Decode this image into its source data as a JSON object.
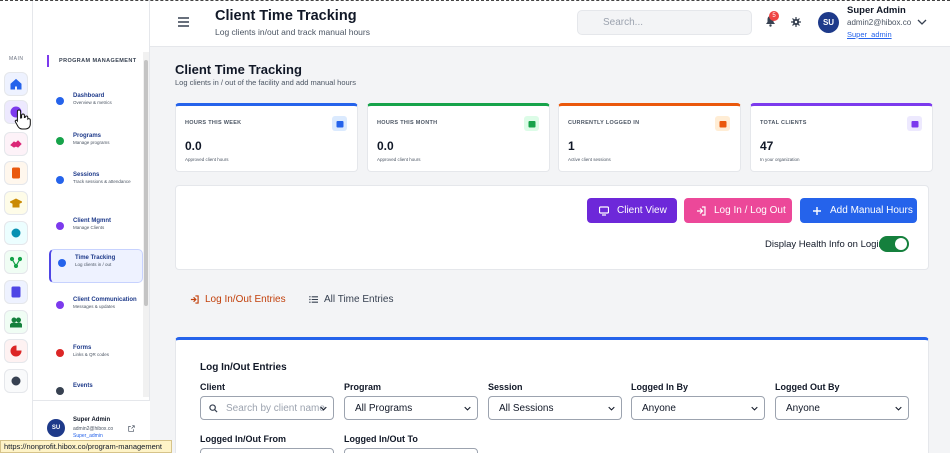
{
  "rail": {
    "label": "MAIN",
    "buttons": [
      {
        "icon": "home-icon",
        "color": "#2563eb",
        "bg": "#eef2ff"
      },
      {
        "icon": "users-circle-icon",
        "color": "#7c3aed",
        "bg": "#ede9fe"
      },
      {
        "icon": "handshake-icon",
        "color": "#db2777",
        "bg": "#fdf2f8"
      },
      {
        "icon": "building-icon",
        "color": "#ea580c",
        "bg": "#fff7ed"
      },
      {
        "icon": "graduation-cap-icon",
        "color": "#ca8a04",
        "bg": "#fefce8"
      },
      {
        "icon": "circle-icon",
        "color": "#0891b2",
        "bg": "#ecfeff"
      },
      {
        "icon": "network-icon",
        "color": "#16a34a",
        "bg": "#f0fdf4"
      },
      {
        "icon": "report-icon",
        "color": "#4f46e5",
        "bg": "#eef2ff"
      },
      {
        "icon": "team-icon",
        "color": "#15803d",
        "bg": "#f0fdf4"
      },
      {
        "icon": "pie-chart-icon",
        "color": "#dc2626",
        "bg": "#fef2f2"
      },
      {
        "icon": "settings-icon",
        "color": "#374151",
        "bg": "#f9fafb"
      }
    ]
  },
  "nav": {
    "heading": "PROGRAM MANAGEMENT",
    "items": [
      {
        "title": "Dashboard",
        "sub": "Overview & metrics",
        "icon": "dashboard-icon"
      },
      {
        "title": "Programs",
        "sub": "Manage programs",
        "icon": "programs-icon"
      },
      {
        "title": "Sessions",
        "sub": "Track sessions & attendance",
        "icon": "sessions-icon"
      },
      {
        "title": "Client Mgmnt",
        "sub": "Manage Clients",
        "icon": "clients-icon"
      },
      {
        "title": "Time Tracking",
        "sub": "Log clients in / out",
        "icon": "clock-icon"
      },
      {
        "title": "Client Communication",
        "sub": "Messages & updates",
        "icon": "chat-icon"
      },
      {
        "title": "Forms",
        "sub": "Links & QR codes",
        "icon": "forms-icon"
      },
      {
        "title": "Events",
        "sub": "",
        "icon": "events-icon"
      }
    ],
    "user": {
      "initials": "SU",
      "name": "Super Admin",
      "email": "admin2@hibox.co",
      "role": "Super_admin"
    }
  },
  "header": {
    "title": "Client Time Tracking",
    "subtitle": "Log clients in/out and track manual hours",
    "search_placeholder": "Search...",
    "notifications": "5",
    "user": {
      "initials": "SU",
      "name": "Super Admin",
      "email": "admin2@hibox.co",
      "role": "Super_admin"
    }
  },
  "page": {
    "title": "Client Time Tracking",
    "subtitle": "Log clients in / out of the facility and add manual hours"
  },
  "stats": [
    {
      "label": "HOURS THIS WEEK",
      "value": "0.0",
      "sub": "Approved client hours",
      "color": "#2563eb"
    },
    {
      "label": "HOURS THIS MONTH",
      "value": "0.0",
      "sub": "Approved client hours",
      "color": "#16a34a"
    },
    {
      "label": "CURRENTLY LOGGED IN",
      "value": "1",
      "sub": "Active client sessions",
      "color": "#ea580c"
    },
    {
      "label": "TOTAL CLIENTS",
      "value": "47",
      "sub": "In your organization",
      "color": "#7c3aed"
    }
  ],
  "actions": {
    "client_view": "Client View",
    "log_in_out": "Log In / Log Out",
    "add_manual": "Add Manual Hours",
    "health_label": "Display Health Info on Login",
    "health_on": true
  },
  "tabs": {
    "entries": "Log In/Out Entries",
    "all_time": "All Time Entries"
  },
  "filters": {
    "title": "Log In/Out Entries",
    "client_label": "Client",
    "client_placeholder": "Search by client name",
    "program_label": "Program",
    "program_value": "All Programs",
    "session_label": "Session",
    "session_value": "All Sessions",
    "logged_in_by_label": "Logged In By",
    "logged_in_by_value": "Anyone",
    "logged_out_by_label": "Logged Out By",
    "logged_out_by_value": "Anyone",
    "from_label": "Logged In/Out From",
    "to_label": "Logged In/Out To"
  },
  "status_url": "https://nonprofit.hibox.co/program-management"
}
